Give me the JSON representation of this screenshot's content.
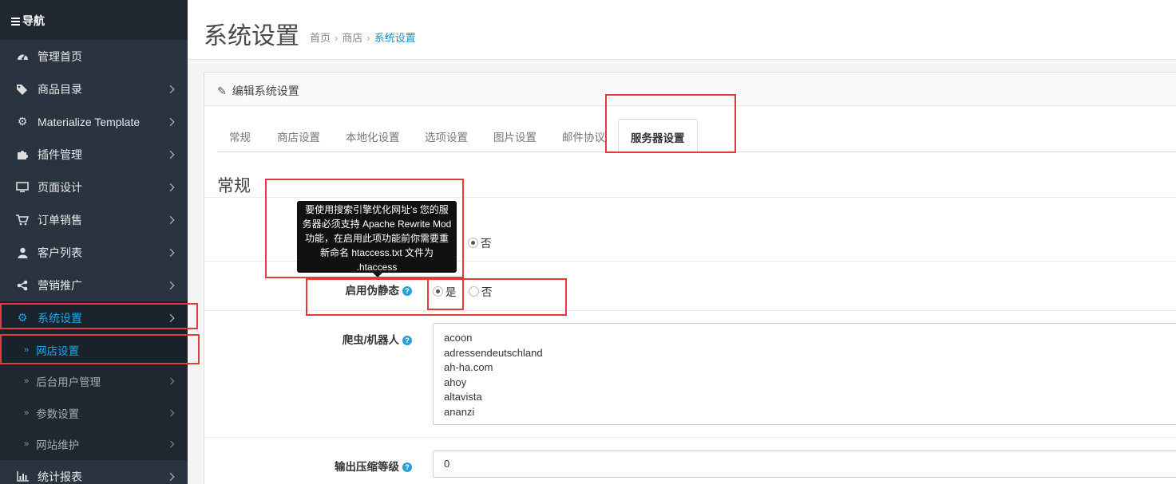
{
  "sidebar": {
    "header": "导航",
    "items": [
      {
        "label": "管理首页",
        "icon": "dashboard-icon"
      },
      {
        "label": "商品目录",
        "icon": "tags-icon"
      },
      {
        "label": "Materialize Template",
        "icon": "cogs-icon"
      },
      {
        "label": "插件管理",
        "icon": "puzzle-icon"
      },
      {
        "label": "页面设计",
        "icon": "desktop-icon"
      },
      {
        "label": "订单销售",
        "icon": "cart-icon"
      },
      {
        "label": "客户列表",
        "icon": "user-icon"
      },
      {
        "label": "营销推广",
        "icon": "share-icon"
      },
      {
        "label": "系统设置",
        "icon": "gear-icon"
      }
    ],
    "sub_items": [
      {
        "label": "网店设置"
      },
      {
        "label": "后台用户管理"
      },
      {
        "label": "参数设置"
      },
      {
        "label": "网站维护"
      }
    ],
    "last_item": {
      "label": "统计报表",
      "icon": "bar-chart-icon"
    }
  },
  "header": {
    "title": "系统设置",
    "breadcrumb": [
      "首页",
      "商店",
      "系统设置"
    ]
  },
  "panel": {
    "heading": "编辑系统设置",
    "tabs": [
      "常规",
      "商店设置",
      "本地化设置",
      "选项设置",
      "图片设置",
      "邮件协议",
      "服务器设置"
    ],
    "active_tab": "服务器设置",
    "section_title": "常规"
  },
  "form": {
    "row1_no": "否",
    "seo_label": "启用伪静态",
    "seo_yes": "是",
    "seo_no": "否",
    "robots_label": "爬虫/机器人",
    "robots": [
      "acoon",
      "adressendeutschland",
      "ah-ha.com",
      "ahoy",
      "altavista",
      "ananzi"
    ],
    "compress_label": "输出压缩等级",
    "compress_value": "0",
    "help_glyph": "?"
  },
  "tooltip": {
    "text": "要使用搜索引擎优化网址's 您的服务器必须支持 Apache Rewrite Mod 功能，在启用此项功能前你需要重新命名 htaccess.txt 文件为 .htaccess"
  },
  "colors": {
    "accent": "#22a6e9",
    "highlight": "#e23b3b",
    "sidebar_bg": "#2a3440"
  }
}
